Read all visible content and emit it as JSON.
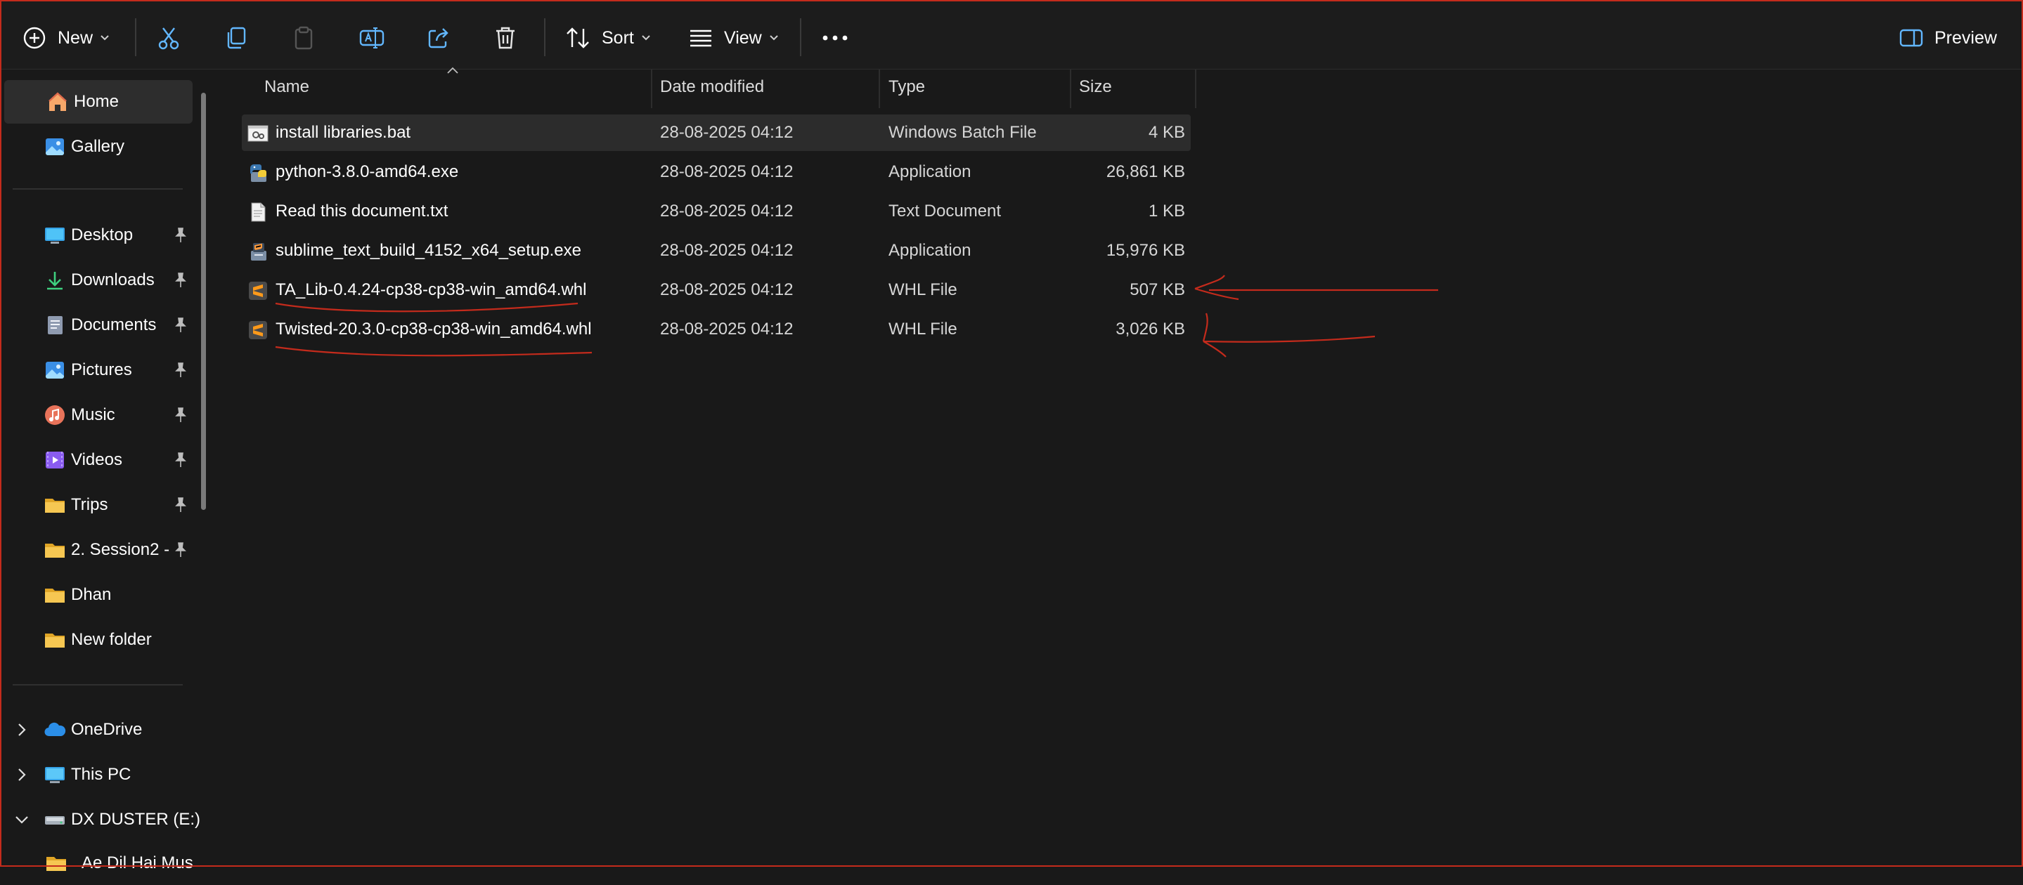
{
  "toolbar": {
    "new_label": "New",
    "sort_label": "Sort",
    "view_label": "View",
    "preview_label": "Preview",
    "icons": [
      "plus-circle-icon",
      "cut-icon",
      "copy-icon",
      "paste-icon",
      "rename-icon",
      "share-icon",
      "delete-icon",
      "sort-icon",
      "view-icon",
      "more-icon",
      "preview-pane-icon"
    ]
  },
  "sidebar": {
    "top": [
      {
        "label": "Home",
        "icon": "home-icon",
        "selected": true
      },
      {
        "label": "Gallery",
        "icon": "gallery-icon"
      }
    ],
    "quick_access": [
      {
        "label": "Desktop",
        "icon": "desktop-icon",
        "pinned": true
      },
      {
        "label": "Downloads",
        "icon": "download-icon",
        "pinned": true
      },
      {
        "label": "Documents",
        "icon": "documents-icon",
        "pinned": true
      },
      {
        "label": "Pictures",
        "icon": "pictures-icon",
        "pinned": true
      },
      {
        "label": "Music",
        "icon": "music-icon",
        "pinned": true
      },
      {
        "label": "Videos",
        "icon": "videos-icon",
        "pinned": true
      },
      {
        "label": "Trips",
        "icon": "folder-icon",
        "pinned": true
      },
      {
        "label": "2. Session2 -",
        "icon": "folder-icon",
        "pinned": true
      },
      {
        "label": "Dhan",
        "icon": "folder-icon"
      },
      {
        "label": "New folder",
        "icon": "folder-icon"
      }
    ],
    "locations": [
      {
        "label": "OneDrive",
        "icon": "cloud-icon",
        "expanded": false
      },
      {
        "label": "This PC",
        "icon": "pc-icon",
        "expanded": false
      },
      {
        "label": "DX DUSTER (E:)",
        "icon": "drive-icon",
        "expanded": true
      }
    ],
    "partial_item": "Ae Dil Hai Mus"
  },
  "columns": {
    "name": "Name",
    "date": "Date modified",
    "type": "Type",
    "size": "Size"
  },
  "files": [
    {
      "name": "install libraries.bat",
      "date": "28-08-2025 04:12",
      "type": "Windows Batch File",
      "size": "4 KB",
      "icon": "batch-file-icon",
      "selected": true
    },
    {
      "name": "python-3.8.0-amd64.exe",
      "date": "28-08-2025 04:12",
      "type": "Application",
      "size": "26,861 KB",
      "icon": "python-installer-icon"
    },
    {
      "name": "Read this document.txt",
      "date": "28-08-2025 04:12",
      "type": "Text Document",
      "size": "1 KB",
      "icon": "text-file-icon"
    },
    {
      "name": "sublime_text_build_4152_x64_setup.exe",
      "date": "28-08-2025 04:12",
      "type": "Application",
      "size": "15,976 KB",
      "icon": "setup-installer-icon"
    },
    {
      "name": "TA_Lib-0.4.24-cp38-cp38-win_amd64.whl",
      "date": "28-08-2025 04:12",
      "type": "WHL File",
      "size": "507 KB",
      "icon": "sublime-file-icon"
    },
    {
      "name": "Twisted-20.3.0-cp38-cp38-win_amd64.whl",
      "date": "28-08-2025 04:12",
      "type": "WHL File",
      "size": "3,026 KB",
      "icon": "sublime-file-icon"
    }
  ],
  "colors": {
    "background": "#191919",
    "selected_row": "#2c2c2c",
    "annotation_ink": "#c42b1c",
    "folder": "#f2c14e",
    "accent": "#4cc2ff"
  }
}
